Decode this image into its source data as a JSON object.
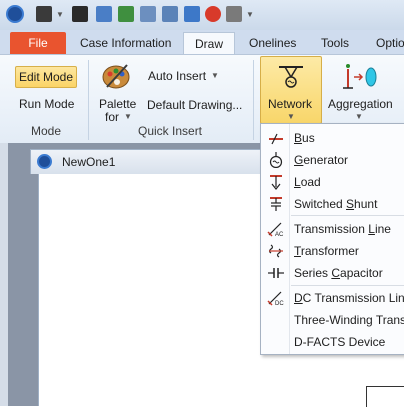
{
  "tabs": {
    "file": "File",
    "case_information": "Case Information",
    "draw": "Draw",
    "onelines": "Onelines",
    "tools": "Tools",
    "options": "Optio"
  },
  "ribbon": {
    "mode": {
      "edit_mode": "Edit Mode",
      "run_mode": "Run Mode",
      "label": "Mode"
    },
    "quick_insert": {
      "palette_line1": "Palette",
      "palette_line2": "for",
      "auto_insert": "Auto Insert",
      "default_drawing": "Default Drawing...",
      "label": "Quick Insert"
    },
    "network": "Network",
    "aggregation": "Aggregation"
  },
  "document": {
    "title": "NewOne1"
  },
  "network_menu": {
    "items": [
      {
        "label": "Bus",
        "icon": "bus-icon"
      },
      {
        "label": "Generator",
        "icon": "generator-icon"
      },
      {
        "label": "Load",
        "icon": "load-icon"
      },
      {
        "label": "Switched Shunt",
        "icon": "switched-shunt-icon"
      },
      {
        "label": "Transmission Line",
        "icon": "transmission-line-icon"
      },
      {
        "label": "Transformer",
        "icon": "transformer-icon"
      },
      {
        "label": "Series Capacitor",
        "icon": "series-capacitor-icon"
      },
      {
        "label": "DC Transmission Line",
        "icon": "dc-transmission-line-icon"
      },
      {
        "label": "Three-Winding Transf",
        "icon": "three-winding-transformer-icon"
      },
      {
        "label": "D-FACTS Device",
        "icon": "dfacts-device-icon"
      }
    ]
  },
  "colors": {
    "file_tab": "#e9542f",
    "highlight": "#fbd466",
    "ribbon_bg": "#e3ecf6"
  }
}
